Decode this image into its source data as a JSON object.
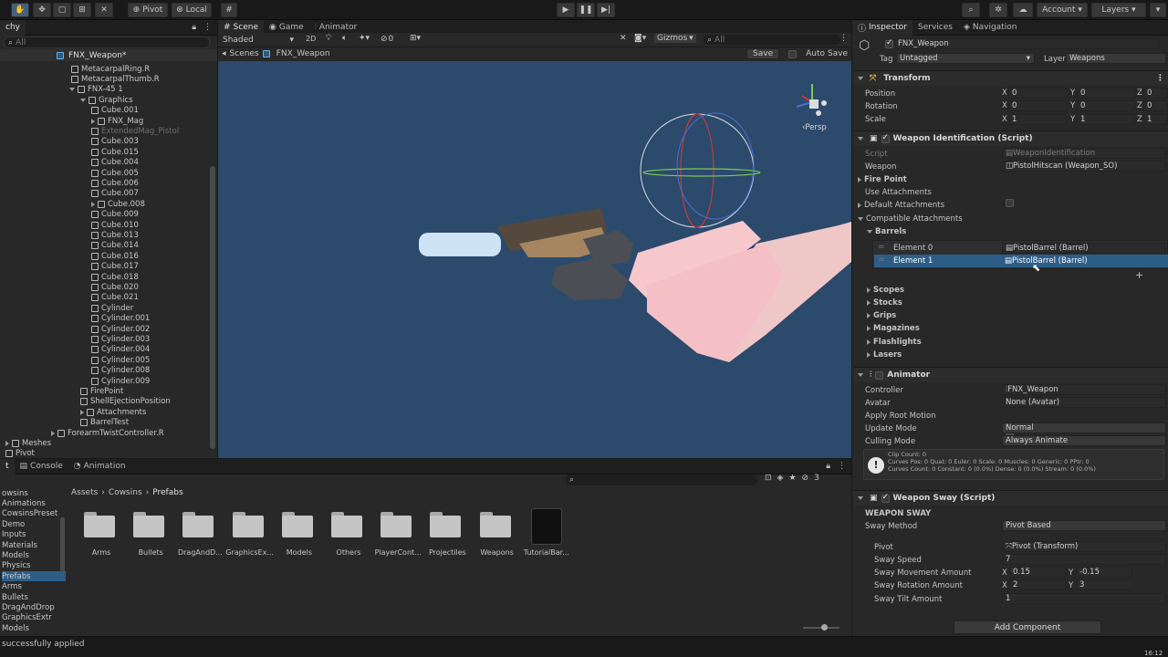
{
  "toolbar": {
    "pivot_label": "Pivot",
    "local_label": "Local",
    "account_label": "Account",
    "layers_label": "Layers"
  },
  "hierarchy": {
    "tab_label": "chy",
    "search_placeholder": "All",
    "root_label": "FNX_Weapon*",
    "items": [
      "MetacarpalRing.R",
      "MetacarpalThumb.R",
      "FNX-45 1",
      "Graphics",
      "Cube.001",
      "FNX_Mag",
      "ExtendedMag_Pistol",
      "Cube.003",
      "Cube.015",
      "Cube.004",
      "Cube.005",
      "Cube.006",
      "Cube.007",
      "Cube.008",
      "Cube.009",
      "Cube.010",
      "Cube.013",
      "Cube.014",
      "Cube.016",
      "Cube.017",
      "Cube.018",
      "Cube.020",
      "Cube.021",
      "Cylinder",
      "Cylinder.001",
      "Cylinder.002",
      "Cylinder.003",
      "Cylinder.004",
      "Cylinder.005",
      "Cylinder.008",
      "Cylinder.009",
      "FirePoint",
      "ShellEjectionPosition",
      "Attachments",
      "BarrelTest",
      "ForearmTwistController.R",
      "Meshes",
      "Pivot"
    ]
  },
  "scene": {
    "tabs": [
      "Scene",
      "Game",
      "Animator"
    ],
    "shading": "Shaded",
    "mode_2d": "2D",
    "gizmo_count": "0",
    "gizmos_label": "Gizmos",
    "search_placeholder": "All",
    "breadcrumb_root": "Scenes",
    "breadcrumb_item": "FNX_Weapon",
    "save_label": "Save",
    "autosave_label": "Auto Save",
    "persp_label": "‹Persp"
  },
  "project": {
    "tabs": [
      "t",
      "Console",
      "Animation"
    ],
    "breadcrumb": [
      "Assets",
      "Cowsins",
      "Prefabs"
    ],
    "count": "3",
    "tree": [
      "owsins",
      "Animations",
      "CowsinsPreset",
      "Demo",
      "Inputs",
      "Materials",
      "Models",
      "Physics",
      "Prefabs",
      "Arms",
      "Bullets",
      "DragAndDrop",
      "GraphicsExtr",
      "Models"
    ],
    "assets": [
      "Arms",
      "Bullets",
      "DragAndD...",
      "GraphicsEx...",
      "Models",
      "Others",
      "PlayerCont...",
      "Projectiles",
      "Weapons",
      "TutorialBar..."
    ]
  },
  "status": {
    "message": "successfully applied",
    "time": "16:12"
  },
  "inspector": {
    "tabs": [
      "Inspector",
      "Services",
      "Navigation"
    ],
    "object_name": "FNX_Weapon",
    "tag_label": "Tag",
    "tag_value": "Untagged",
    "layer_label": "Layer",
    "layer_value": "Weapons",
    "transform": {
      "title": "Transform",
      "rows": [
        {
          "label": "Position",
          "x": "0",
          "y": "0",
          "z": "0"
        },
        {
          "label": "Rotation",
          "x": "0",
          "y": "0",
          "z": "0"
        },
        {
          "label": "Scale",
          "x": "1",
          "y": "1",
          "z": "1"
        }
      ]
    },
    "weapon_id": {
      "title": "Weapon Identification (Script)",
      "script_label": "Script",
      "script_value": "WeaponIdentification",
      "weapon_label": "Weapon",
      "weapon_value": "PistolHitscan (Weapon_SO)",
      "fire_point": "Fire Point",
      "use_attachments": "Use Attachments",
      "default_attachments": "Default Attachments",
      "compatible_attachments": "Compatible Attachments",
      "barrels": "Barrels",
      "elements": [
        {
          "label": "Element 0",
          "value": "PistolBarrel (Barrel)"
        },
        {
          "label": "Element 1",
          "value": "PistolBarrel (Barrel)"
        }
      ],
      "groups": [
        "Scopes",
        "Stocks",
        "Grips",
        "Magazines",
        "Flashlights",
        "Lasers"
      ]
    },
    "animator": {
      "title": "Animator",
      "controller_label": "Controller",
      "controller_value": "FNX_Weapon",
      "avatar_label": "Avatar",
      "avatar_value": "None (Avatar)",
      "root_motion_label": "Apply Root Motion",
      "update_mode_label": "Update Mode",
      "update_mode_value": "Normal",
      "culling_label": "Culling Mode",
      "culling_value": "Always Animate",
      "info_line1": "Clip Count: 0",
      "info_line2": "Curves Pos: 0 Quat: 0 Euler: 0 Scale: 0 Muscles: 0 Generic: 0 PPtr: 0",
      "info_line3": "Curves Count: 0 Constant: 0 (0.0%) Dense: 0 (0.0%) Stream: 0 (0.0%)"
    },
    "sway": {
      "title": "Weapon Sway (Script)",
      "section": "WEAPON SWAY",
      "method_label": "Sway Method",
      "method_value": "Pivot Based",
      "pivot_label": "Pivot",
      "pivot_value": "Pivot (Transform)",
      "speed_label": "Sway Speed",
      "speed_value": "7",
      "move_label": "Sway Movement Amount",
      "move_x": "0.15",
      "move_y": "-0.15",
      "rot_label": "Sway Rotation Amount",
      "rot_x": "2",
      "rot_y": "3",
      "tilt_label": "Sway Tilt Amount",
      "tilt_value": "1"
    },
    "add_component": "Add Component"
  },
  "colors": {
    "scene_bg": "#2b4a6c",
    "selected": "#2c5d87",
    "accent": "#46607c"
  }
}
